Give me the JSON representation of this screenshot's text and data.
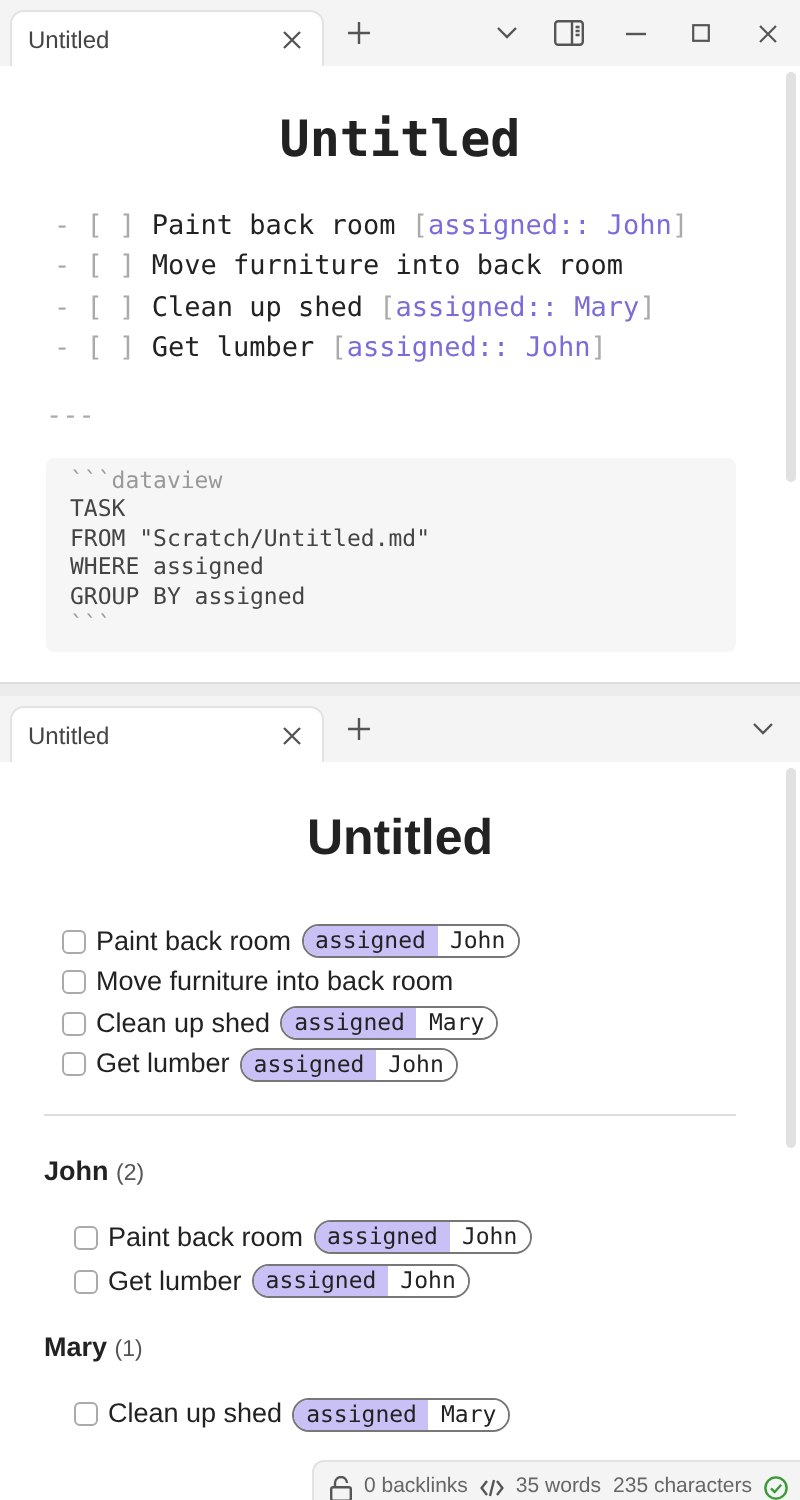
{
  "source_pane": {
    "tabs": [
      {
        "label": "Untitled",
        "selected": true
      }
    ],
    "title": "Untitled",
    "lines": [
      {
        "dash": "-",
        "box": "[ ]",
        "text": "Paint back room",
        "bracket_open": "[",
        "field": "assigned:: John",
        "bracket_close": "]"
      },
      {
        "dash": "-",
        "box": "[ ]",
        "text": "Move furniture into back room"
      },
      {
        "dash": "-",
        "box": "[ ]",
        "text": "Clean up shed",
        "bracket_open": "[",
        "field": "assigned:: Mary",
        "bracket_close": "]"
      },
      {
        "dash": "-",
        "box": "[ ]",
        "text": "Get lumber",
        "bracket_open": "[",
        "field": "assigned:: John",
        "bracket_close": "]"
      }
    ],
    "rule": "---",
    "code": [
      "```dataview",
      "TASK",
      "FROM \"Scratch/Untitled.md\"",
      "WHERE assigned",
      "GROUP BY assigned",
      "```"
    ]
  },
  "preview_pane": {
    "tabs": [
      {
        "label": "Untitled",
        "selected": true
      }
    ],
    "title": "Untitled",
    "tasks": [
      {
        "text": "Paint back room",
        "checked": false,
        "key": "assigned",
        "value": "John"
      },
      {
        "text": "Move furniture into back room",
        "checked": false
      },
      {
        "text": "Clean up shed",
        "checked": false,
        "key": "assigned",
        "value": "Mary"
      },
      {
        "text": "Get lumber",
        "checked": false,
        "key": "assigned",
        "value": "John"
      }
    ],
    "groups": [
      {
        "name": "John",
        "count": "(2)",
        "tasks": [
          {
            "text": "Paint back room",
            "checked": false,
            "key": "assigned",
            "value": "John"
          },
          {
            "text": "Get lumber",
            "checked": false,
            "key": "assigned",
            "value": "John"
          }
        ]
      },
      {
        "name": "Mary",
        "count": "(1)",
        "tasks": [
          {
            "text": "Clean up shed",
            "checked": false,
            "key": "assigned",
            "value": "Mary"
          }
        ]
      }
    ]
  },
  "status_bar": {
    "backlinks": "0 backlinks",
    "words": "35 words",
    "characters": "235 characters"
  }
}
